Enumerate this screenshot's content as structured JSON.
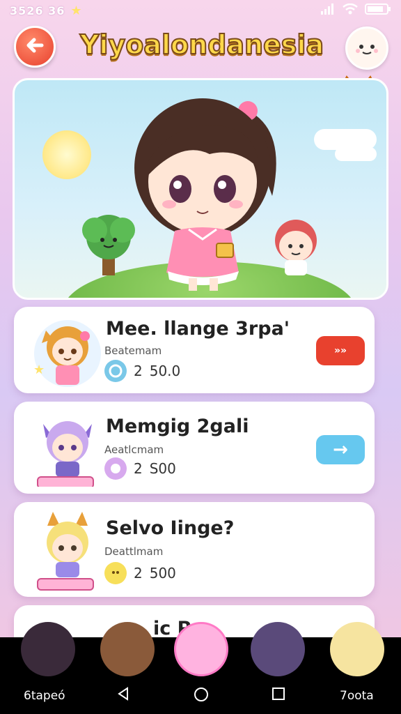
{
  "status": {
    "time": "3526 36",
    "icons": [
      "star-icon",
      "signal-icon",
      "wifi-icon",
      "battery-icon"
    ]
  },
  "header": {
    "title": "Yiyoalondanesia",
    "back_icon": "arrow-left-icon",
    "profile_icon": "smiley-face-icon"
  },
  "cards": [
    {
      "name": "Mee. llange 3rpa'",
      "subtitle": "Beatemam",
      "score_prefix": "2",
      "score": "50.0",
      "badge_text": "",
      "action_label": "»»",
      "action_color": "#e8412e",
      "coin_color": "#7ac8e8",
      "action_icon": "double-arrow-icon"
    },
    {
      "name": "Memgig 2gali",
      "subtitle": "Aeatlcmam",
      "score_prefix": "2",
      "score": "S00",
      "badge_text": "",
      "action_label": "→",
      "action_color": "#66c8ef",
      "coin_color": "#d7a9ee",
      "action_icon": "arrow-right-icon"
    },
    {
      "name": "Selvo Iinge?",
      "subtitle": "Deattlmam",
      "score_prefix": "2",
      "score": "500",
      "badge_text": "",
      "action_label": "",
      "action_color": "",
      "coin_color": "#f7df5a",
      "action_icon": ""
    },
    {
      "name": "ic Pa..",
      "subtitle": "",
      "score_prefix": "",
      "score": "",
      "badge_text": "",
      "action_label": "",
      "action_color": "",
      "coin_color": "",
      "action_icon": ""
    }
  ],
  "bottom_nav": {
    "left_label": "6tapeó",
    "right_label": "7oota",
    "icons": [
      "back-triangle-icon",
      "home-circle-icon",
      "recents-square-icon"
    ]
  },
  "colors": {
    "accent_red": "#e8412e",
    "accent_blue": "#66c8ef",
    "title_yellow": "#ffd84a"
  }
}
